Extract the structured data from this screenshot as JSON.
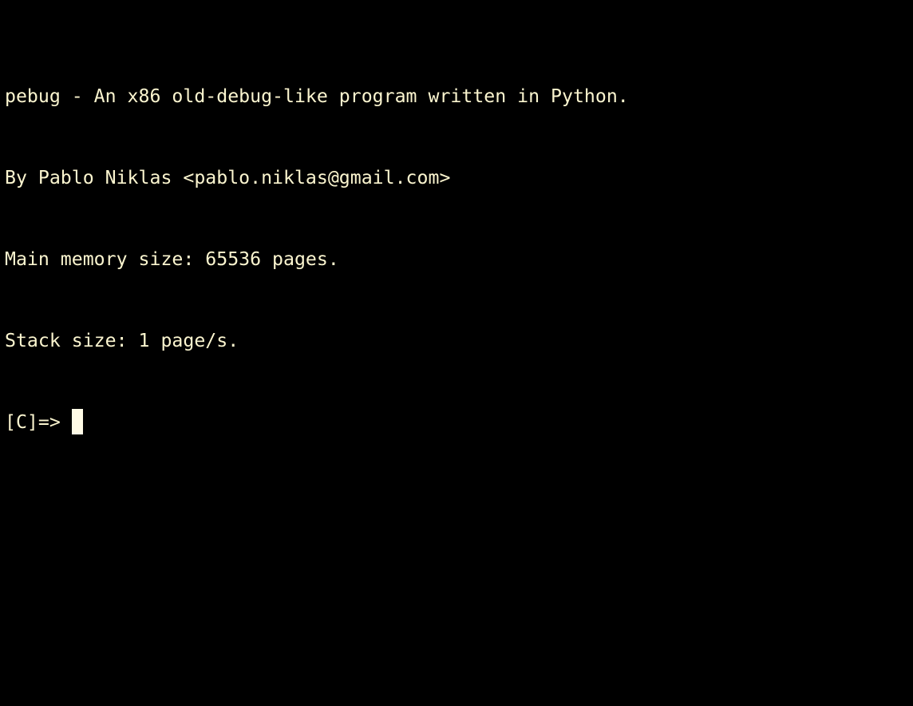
{
  "terminal": {
    "lines": [
      "pebug - An x86 old-debug-like program written in Python.",
      "By Pablo Niklas <pablo.niklas@gmail.com>",
      "Main memory size: 65536 pages.",
      "Stack size: 1 page/s."
    ],
    "prompt": "[C]=> ",
    "input": "",
    "colors": {
      "background": "#000000",
      "foreground": "#fbf5cf",
      "cursor": "#fffbe6"
    }
  }
}
